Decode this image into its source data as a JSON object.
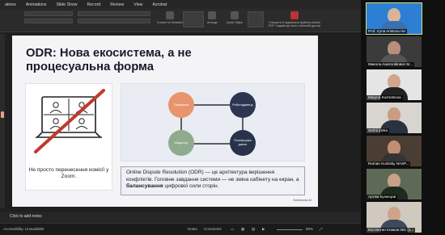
{
  "ribbon": {
    "tabs": [
      "ations",
      "Animations",
      "Slide Show",
      "Record",
      "Review",
      "View",
      "Acrobat"
    ],
    "convert_label": "Convert to SmartArt",
    "arrange_label": "Arrange",
    "quick_styles_label": "Quick Styles",
    "pdf_label": "Створити й поділитися файлом Adobe PDF і надати до нього спільний доступ"
  },
  "slide": {
    "title": "ODR: Нова екосистема, а не процесуальна форма",
    "left_caption": "Не просто перенесення комісії у Zoom.",
    "body_pre": "Online Dispute Resolution (ODR) — це архітектура вирішення конфліктів. Головне завдання системи — не зміна кабінету на екран, а ",
    "body_bold": "балансування",
    "body_post": " цифрової сили сторін.",
    "brand": "NotebookLM",
    "diagram": {
      "nodes": [
        {
          "label": "Працівник",
          "color": "#e8956f"
        },
        {
          "label": "Роботодавець",
          "color": "#2c3650"
        },
        {
          "label": "Медіатор",
          "color": "#8eab8e"
        },
        {
          "label": "Платформа даних",
          "color": "#28324a"
        }
      ]
    }
  },
  "notes_placeholder": "Click to add notes",
  "status": {
    "accessibility": "Accessibility: Unavailable",
    "notes_btn": "Notes",
    "comments_btn": "Comments",
    "zoom": "89%"
  },
  "participants": [
    {
      "name": "Prof. Iryna Aristova Не"
    },
    {
      "name": "Микола Анатолійович М..."
    },
    {
      "name": "Maryna Kuznetsova"
    },
    {
      "name": "Serhii Zinko"
    },
    {
      "name": "Roman Kunitsky NASP..."
    },
    {
      "name": "Артем Кузнєцов"
    },
    {
      "name": "Костянтин Кликов 081 (1..."
    }
  ],
  "colors": {
    "cross": "#c0392b",
    "accent_border": "#cfe67d"
  }
}
